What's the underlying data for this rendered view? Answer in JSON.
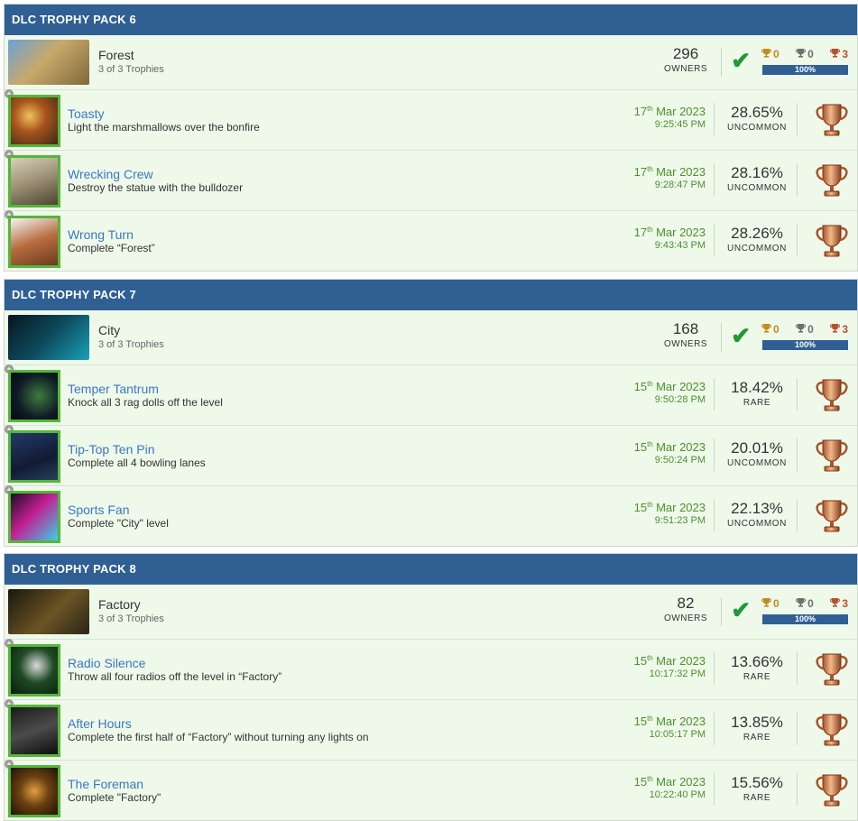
{
  "colors": {
    "header": "#2f5f93",
    "row_bg": "#eef9ea",
    "link": "#3b78c4",
    "date": "#4e8f2e",
    "thumb_border": "#55b639"
  },
  "packs": [
    {
      "header": "DLC TROPHY PACK 6",
      "game": {
        "name": "Forest",
        "trophies_text": "3 of 3 Trophies",
        "owners": "296",
        "owners_label": "OWNERS",
        "gold": "0",
        "silver": "0",
        "bronze": "3",
        "progress": "100%"
      },
      "trophies": [
        {
          "name": "Toasty",
          "desc": "Light the marshmallows over the bonfire",
          "day": "17",
          "suffix": "th",
          "month_year": "Mar 2023",
          "time": "9:25:45 PM",
          "pct": "28.65%",
          "rarity": "UNCOMMON"
        },
        {
          "name": "Wrecking Crew",
          "desc": "Destroy the statue with the bulldozer",
          "day": "17",
          "suffix": "th",
          "month_year": "Mar 2023",
          "time": "9:28:47 PM",
          "pct": "28.16%",
          "rarity": "UNCOMMON"
        },
        {
          "name": "Wrong Turn",
          "desc": "Complete “Forest”",
          "day": "17",
          "suffix": "th",
          "month_year": "Mar 2023",
          "time": "9:43:43 PM",
          "pct": "28.26%",
          "rarity": "UNCOMMON"
        }
      ]
    },
    {
      "header": "DLC TROPHY PACK 7",
      "game": {
        "name": "City",
        "trophies_text": "3 of 3 Trophies",
        "owners": "168",
        "owners_label": "OWNERS",
        "gold": "0",
        "silver": "0",
        "bronze": "3",
        "progress": "100%"
      },
      "trophies": [
        {
          "name": "Temper Tantrum",
          "desc": "Knock all 3 rag dolls off the level",
          "day": "15",
          "suffix": "th",
          "month_year": "Mar 2023",
          "time": "9:50:28 PM",
          "pct": "18.42%",
          "rarity": "RARE"
        },
        {
          "name": "Tip-Top Ten Pin",
          "desc": "Complete all 4 bowling lanes",
          "day": "15",
          "suffix": "th",
          "month_year": "Mar 2023",
          "time": "9:50:24 PM",
          "pct": "20.01%",
          "rarity": "UNCOMMON"
        },
        {
          "name": "Sports Fan",
          "desc": "Complete \"City\" level",
          "day": "15",
          "suffix": "th",
          "month_year": "Mar 2023",
          "time": "9:51:23 PM",
          "pct": "22.13%",
          "rarity": "UNCOMMON"
        }
      ]
    },
    {
      "header": "DLC TROPHY PACK 8",
      "game": {
        "name": "Factory",
        "trophies_text": "3 of 3 Trophies",
        "owners": "82",
        "owners_label": "OWNERS",
        "gold": "0",
        "silver": "0",
        "bronze": "3",
        "progress": "100%"
      },
      "trophies": [
        {
          "name": "Radio Silence",
          "desc": "Throw all four radios off the level in “Factory”",
          "day": "15",
          "suffix": "th",
          "month_year": "Mar 2023",
          "time": "10:17:32 PM",
          "pct": "13.66%",
          "rarity": "RARE"
        },
        {
          "name": "After Hours",
          "desc": "Complete the first half of “Factory” without turning any lights on",
          "day": "15",
          "suffix": "th",
          "month_year": "Mar 2023",
          "time": "10:05:17 PM",
          "pct": "13.85%",
          "rarity": "RARE"
        },
        {
          "name": "The Foreman",
          "desc": "Complete \"Factory\"",
          "day": "15",
          "suffix": "th",
          "month_year": "Mar 2023",
          "time": "10:22:40 PM",
          "pct": "15.56%",
          "rarity": "RARE"
        }
      ]
    }
  ]
}
